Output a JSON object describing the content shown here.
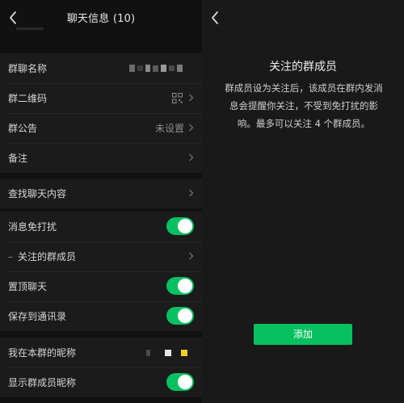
{
  "chat_info": {
    "title": "聊天信息 (10)",
    "items": {
      "group_name": {
        "label": "群聊名称"
      },
      "qr_code": {
        "label": "群二维码"
      },
      "announcement": {
        "label": "群公告",
        "value": "未设置"
      },
      "remark": {
        "label": "备注"
      },
      "search_history": {
        "label": "查找聊天内容"
      },
      "do_not_disturb": {
        "label": "消息免打扰",
        "on": true
      },
      "followed_members": {
        "label": "关注的群成员",
        "prefix": "–"
      },
      "pin_chat": {
        "label": "置顶聊天",
        "on": true
      },
      "save_to_contacts": {
        "label": "保存到通讯录",
        "on": true
      },
      "my_nickname": {
        "label": "我在本群的昵称"
      },
      "show_nicknames": {
        "label": "显示群成员昵称",
        "on": true
      }
    }
  },
  "follow_panel": {
    "title": "关注的群成员",
    "description": "群成员设为关注后，该成员在群内发消息会提醒你关注，不受到免打扰的影响。最多可以关注 4 个群成员。",
    "add_button": "添加"
  },
  "colors": {
    "accent": "#07c160",
    "background": "#111111",
    "panel": "#1b1b1b"
  }
}
